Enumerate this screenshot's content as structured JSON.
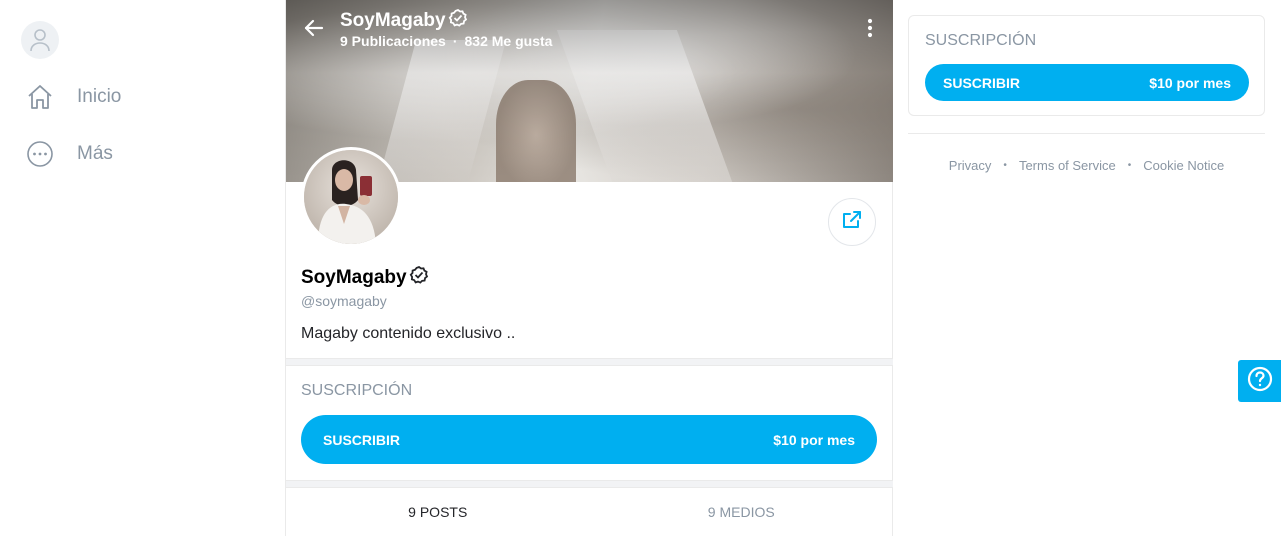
{
  "nav": {
    "items": [
      {
        "label": "Inicio",
        "icon": "home-icon"
      },
      {
        "label": "Más",
        "icon": "more-icon"
      }
    ]
  },
  "profile": {
    "cover_title": "SoyMagaby",
    "posts_stat": "9 Publicaciones",
    "likes_stat": "832 Me gusta",
    "name": "SoyMagaby",
    "handle": "@soymagaby",
    "bio": "Magaby contenido exclusivo .."
  },
  "subscription": {
    "title": "SUSCRIPCIÓN",
    "button_label": "SUSCRIBIR",
    "price": "$10 por mes"
  },
  "tabs": [
    {
      "label": "9 POSTS"
    },
    {
      "label": "9 MEDIOS"
    }
  ],
  "sidebar_card": {
    "title": "SUSCRIPCIÓN",
    "button_label": "SUSCRIBIR",
    "price": "$10 por mes"
  },
  "footer": {
    "privacy": "Privacy",
    "terms": "Terms of Service",
    "cookie": "Cookie Notice"
  },
  "colors": {
    "accent": "#00aff0",
    "muted": "#8a96a3"
  }
}
